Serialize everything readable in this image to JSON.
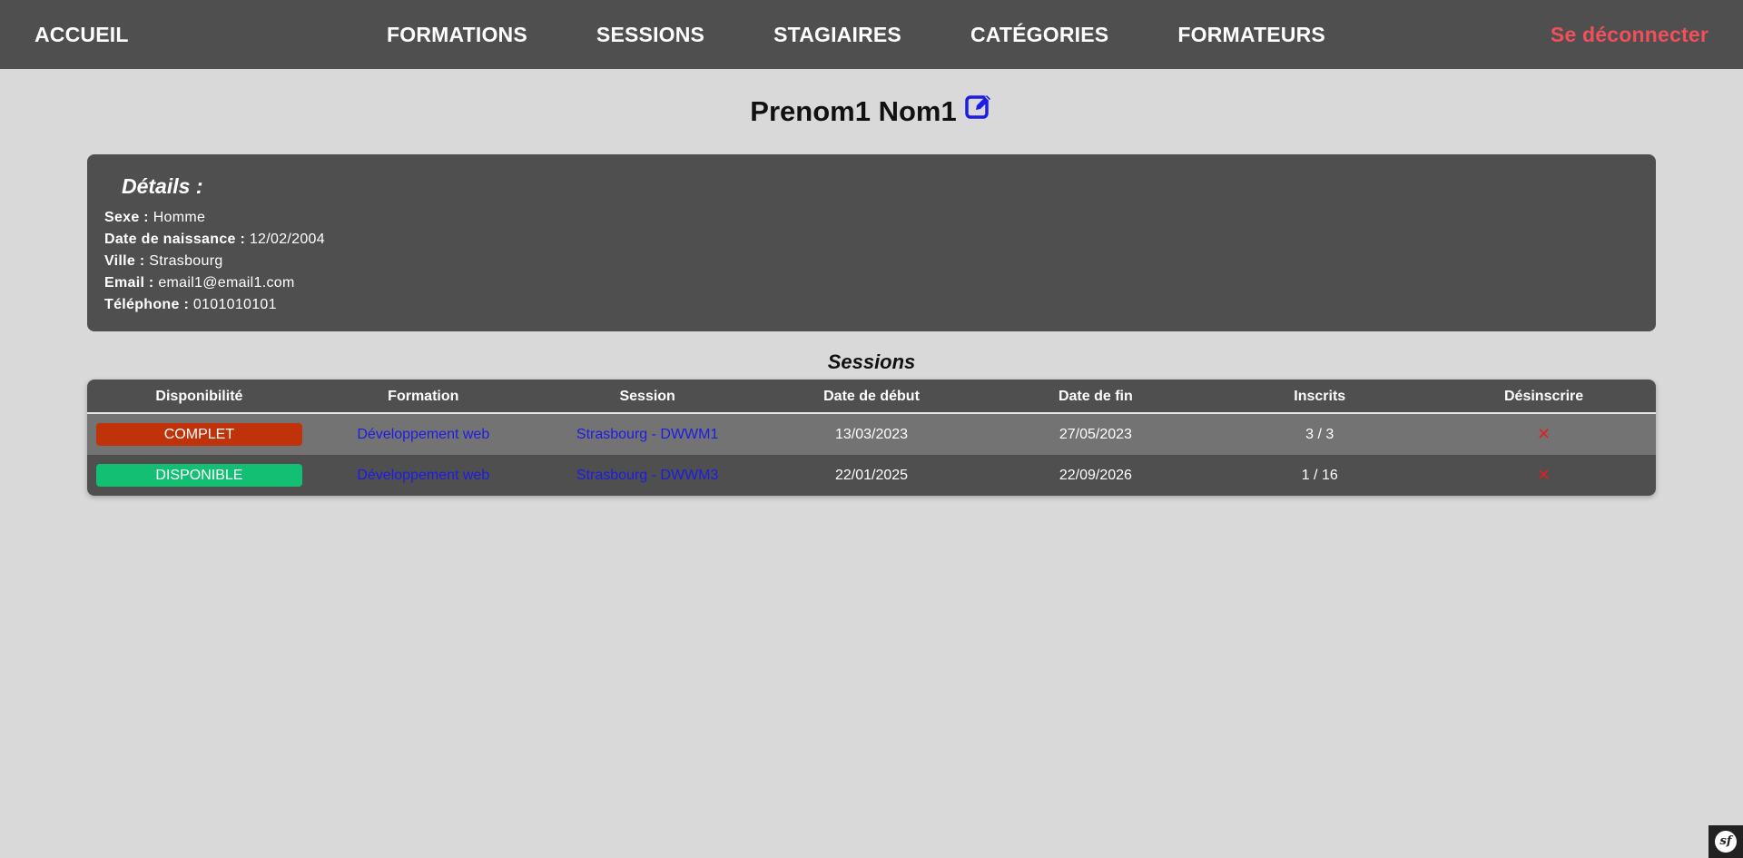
{
  "nav": {
    "home": "ACCUEIL",
    "items": [
      "FORMATIONS",
      "SESSIONS",
      "STAGIAIRES",
      "CATÉGORIES",
      "FORMATEURS"
    ],
    "logout": "Se déconnecter",
    "logout_color": "#f0505a"
  },
  "page": {
    "title": "Prenom1 Nom1",
    "edit_icon": "edit-icon"
  },
  "details": {
    "title": "Détails :",
    "rows": [
      {
        "label": "Sexe :",
        "value": "Homme"
      },
      {
        "label": "Date de naissance :",
        "value": "12/02/2004"
      },
      {
        "label": "Ville :",
        "value": "Strasbourg"
      },
      {
        "label": "Email :",
        "value": "email1@email1.com"
      },
      {
        "label": "Téléphone :",
        "value": "0101010101"
      }
    ]
  },
  "sessions": {
    "title": "Sessions",
    "headers": [
      "Disponibilité",
      "Formation",
      "Session",
      "Date de début",
      "Date de fin",
      "Inscrits",
      "Désinscrire"
    ],
    "rows": [
      {
        "status": "COMPLET",
        "status_color": "#c0330a",
        "formation": "Développement web",
        "session": "Strasbourg - DWWM1",
        "start": "13/03/2023",
        "end": "27/05/2023",
        "enrolled": "3 / 3",
        "remove": "✕"
      },
      {
        "status": "DISPONIBLE",
        "status_color": "#12bf73",
        "formation": "Développement web",
        "session": "Strasbourg - DWWM3",
        "start": "22/01/2025",
        "end": "22/09/2026",
        "enrolled": "1 / 16",
        "remove": "✕"
      }
    ]
  },
  "colors": {
    "background": "#d9d9d9",
    "panel": "#4f4f4f",
    "row_alt": "#737373",
    "link": "#1c1ce6",
    "edit_icon": "#1c1ce6",
    "remove_icon": "#e02020"
  },
  "toolbar": {
    "logo": "sf"
  }
}
